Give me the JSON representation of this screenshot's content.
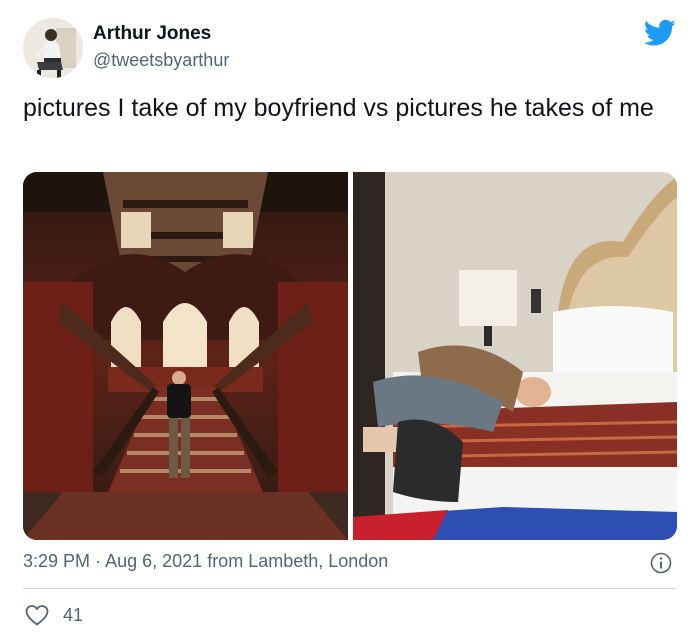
{
  "author": {
    "display_name": "Arthur Jones",
    "handle": "@tweetsbyarthur"
  },
  "tweet": {
    "text": "pictures I take of my boyfriend vs pictures he takes of me"
  },
  "meta": {
    "time": "3:29 PM",
    "separator": "·",
    "date": "Aug 6, 2021",
    "location": "from Lambeth, London"
  },
  "engagement": {
    "likes": "41"
  },
  "icons": {
    "brand": "twitter-bird-icon",
    "info": "info-icon",
    "like": "heart-icon"
  },
  "colors": {
    "brand_blue": "#1d9bf0",
    "secondary_text": "#536471",
    "primary_text": "#0f1419",
    "divider": "#cfd9de"
  }
}
